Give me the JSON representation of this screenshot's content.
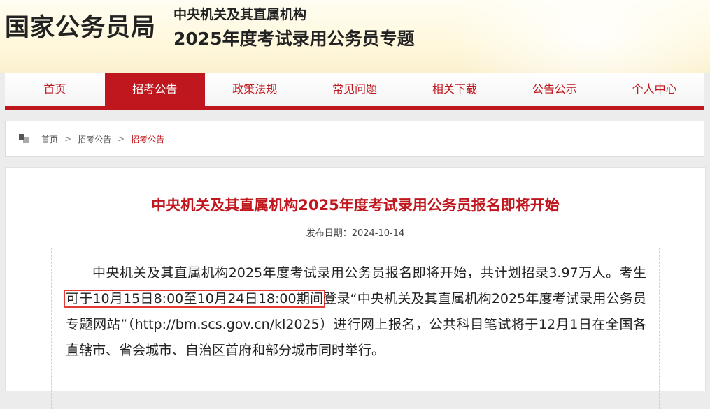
{
  "header": {
    "brand": "国家公务员局",
    "site_subtitle": "中央机关及其直属机构",
    "site_title": "2025年度考试录用公务员专题"
  },
  "nav": {
    "items": [
      {
        "label": "首页"
      },
      {
        "label": "招考公告"
      },
      {
        "label": "政策法规"
      },
      {
        "label": "常见问题"
      },
      {
        "label": "相关下载"
      },
      {
        "label": "公告公示"
      },
      {
        "label": "个人中心"
      }
    ],
    "active_index": 1
  },
  "breadcrumb": {
    "items": [
      "首页",
      "招考公告",
      "招考公告"
    ],
    "separator": ">"
  },
  "article": {
    "title": "中央机关及其直属机构2025年度考试录用公务员报名即将开始",
    "date_label": "发布日期：",
    "date": "2024-10-14",
    "body_before": "中央机关及其直属机构2025年度考试录用公务员报名即将开始，共计划招录3.97万人。考生",
    "body_highlight": "可于10月15日8:00至10月24日18:00期间",
    "body_after": "登录“中央机关及其直属机构2025年度考试录用公务员专题网站”（http://bm.scs.gov.cn/kl2025）进行网上报名，公共科目笔试将于12月1日在全国各直辖市、省会城市、自治区首府和部分城市同时举行。"
  },
  "colors": {
    "brand_red": "#c0171e",
    "highlight_border": "#e53935"
  },
  "icons": {
    "breadcrumb": "location-squares-icon"
  }
}
